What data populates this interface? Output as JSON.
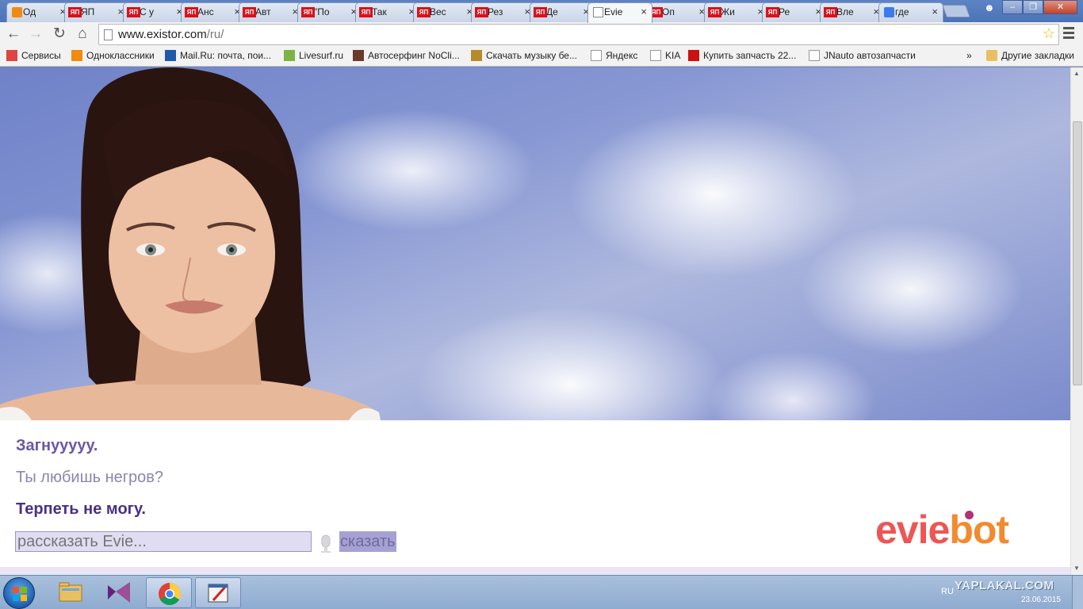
{
  "browser": {
    "tabs": [
      {
        "title": "Од",
        "favicon": "ok"
      },
      {
        "title": "ЯП",
        "favicon": "yap"
      },
      {
        "title": "С у",
        "favicon": "yap"
      },
      {
        "title": "Анс",
        "favicon": "yap"
      },
      {
        "title": "Авт",
        "favicon": "yap"
      },
      {
        "title": "\"По",
        "favicon": "yap"
      },
      {
        "title": "Так",
        "favicon": "yap"
      },
      {
        "title": "Вес",
        "favicon": "yap"
      },
      {
        "title": "Рез",
        "favicon": "yap"
      },
      {
        "title": "Де",
        "favicon": "yap"
      },
      {
        "title": "Evie",
        "favicon": "page"
      },
      {
        "title": "Оп",
        "favicon": "yap"
      },
      {
        "title": "Жи",
        "favicon": "yap"
      },
      {
        "title": "Ре",
        "favicon": "yap"
      },
      {
        "title": "Вле",
        "favicon": "yap"
      },
      {
        "title": "где",
        "favicon": "goog"
      }
    ],
    "yap_favicon_text": "ЯП",
    "url_host": "www.existor.com",
    "url_path": "/ru/",
    "bookmarks": [
      {
        "label": "Сервисы",
        "icon": "apps-icon"
      },
      {
        "label": "Одноклассники",
        "icon": "ok-icon"
      },
      {
        "label": "Mail.Ru: почта, пои...",
        "icon": "mailru-icon"
      },
      {
        "label": "Livesurf.ru",
        "icon": "livesurf-icon"
      },
      {
        "label": "Автосерфинг NoCli...",
        "icon": "autosurf-icon"
      },
      {
        "label": "Скачать музыку бе...",
        "icon": "music-icon"
      },
      {
        "label": "Яндекс",
        "icon": "yandex-icon"
      },
      {
        "label": "KIA",
        "icon": "page-icon"
      },
      {
        "label": "Купить запчасть 22...",
        "icon": "zz-icon"
      },
      {
        "label": "JNauto автозапчасти",
        "icon": "page-icon"
      }
    ],
    "bookmarks_overflow": "»",
    "other_bookmarks": "Другие закладки"
  },
  "page": {
    "chat": {
      "bot_line_prev": "Загнууууу.",
      "user_line": "Ты любишь негров?",
      "bot_line": "Терпеть не могу."
    },
    "input_placeholder": "рассказать Evie...",
    "say_button": "сказать",
    "logo": {
      "part1": "evie",
      "part2": "bot"
    },
    "colors": {
      "bot": "#4a2f86",
      "user": "#8a86ad",
      "logo_red": "#ee5555",
      "logo_orange": "#f28a2e"
    }
  },
  "taskbar": {
    "apps": [
      "explorer-icon",
      "visual-studio-icon",
      "chrome-icon",
      "paint-icon"
    ],
    "lang": "RU",
    "watermark": "YAPLAKAL.COM",
    "date": "23.06.2015"
  }
}
